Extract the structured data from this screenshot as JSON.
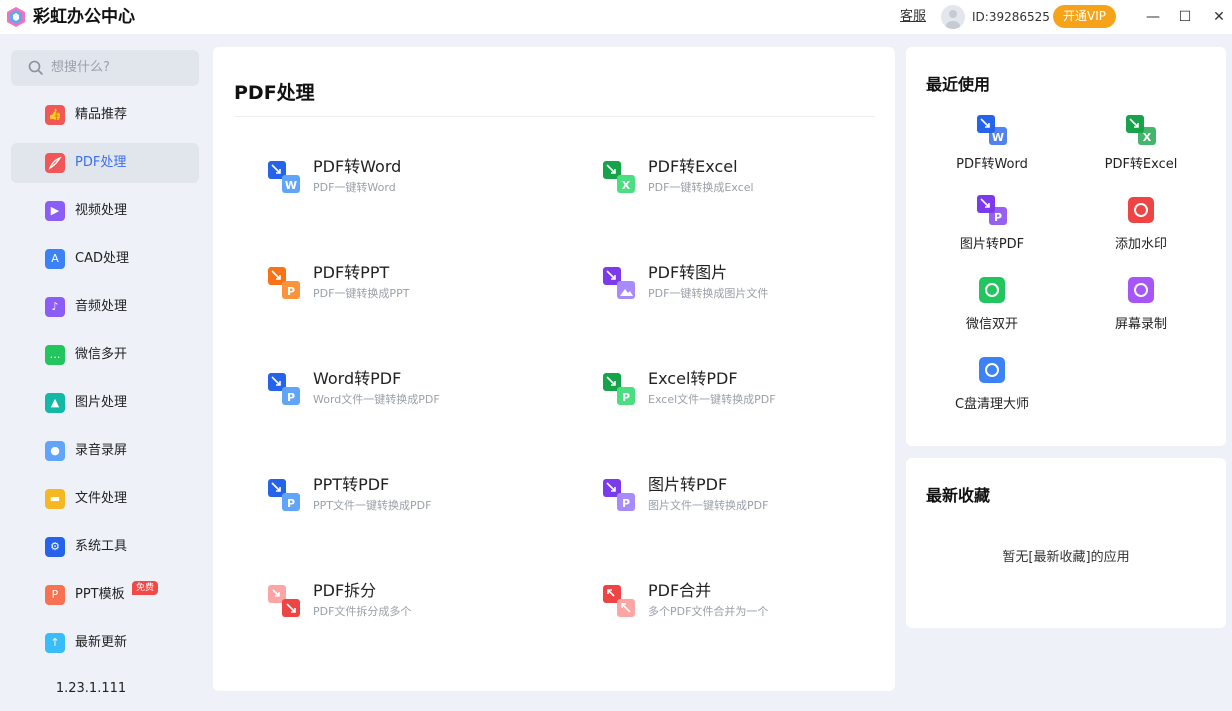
{
  "app": {
    "title": "彩虹办公中心"
  },
  "header": {
    "support": "客服",
    "user_id": "ID:39286525",
    "vip_button": "开通VIP",
    "minimize": "—",
    "maximize": "☐",
    "close": "✕"
  },
  "sidebar": {
    "search_placeholder": "想搜什么?",
    "items": [
      {
        "label": "精品推荐",
        "color": "#f25757"
      },
      {
        "label": "PDF处理",
        "color": "#f25757"
      },
      {
        "label": "视频处理",
        "color": "#8b5cf6"
      },
      {
        "label": "CAD处理",
        "color": "#3b82f6"
      },
      {
        "label": "音频处理",
        "color": "#8b5cf6"
      },
      {
        "label": "微信多开",
        "color": "#22c55e"
      },
      {
        "label": "图片处理",
        "color": "#14b8a6"
      },
      {
        "label": "录音录屏",
        "color": "#60a5fa"
      },
      {
        "label": "文件处理",
        "color": "#f5b823"
      },
      {
        "label": "系统工具",
        "color": "#2563eb"
      },
      {
        "label": "PPT模板",
        "color": "#f87150",
        "badge": "免费"
      },
      {
        "label": "最新更新",
        "color": "#38bdf8"
      }
    ],
    "version": "1.23.1.111"
  },
  "main": {
    "title": "PDF处理",
    "tools": [
      {
        "name": "PDF转Word",
        "desc": "PDF一键转Word",
        "letter": "W",
        "c1": "#2563eb",
        "c2": "#60a5fa"
      },
      {
        "name": "PDF转Excel",
        "desc": "PDF一键转换成Excel",
        "letter": "X",
        "c1": "#16a34a",
        "c2": "#4ade80"
      },
      {
        "name": "PDF转PPT",
        "desc": "PDF一键转换成PPT",
        "letter": "P",
        "c1": "#f97316",
        "c2": "#fb923c"
      },
      {
        "name": "PDF转图片",
        "desc": "PDF一键转换成图片文件",
        "letter": "img",
        "c1": "#7c3aed",
        "c2": "#a78bfa"
      },
      {
        "name": "Word转PDF",
        "desc": "Word文件一键转换成PDF",
        "letter": "P",
        "c1": "#2563eb",
        "c2": "#60a5fa"
      },
      {
        "name": "Excel转PDF",
        "desc": "Excel文件一键转换成PDF",
        "letter": "P",
        "c1": "#16a34a",
        "c2": "#4ade80"
      },
      {
        "name": "PPT转PDF",
        "desc": "PPT文件一键转换成PDF",
        "letter": "P",
        "c1": "#2563eb",
        "c2": "#60a5fa"
      },
      {
        "name": "图片转PDF",
        "desc": "图片文件一键转换成PDF",
        "letter": "P",
        "c1": "#7c3aed",
        "c2": "#a78bfa"
      },
      {
        "name": "PDF拆分",
        "desc": "PDF文件拆分成多个",
        "letter": "split",
        "c1": "#ef4444",
        "c2": "#fca5a5"
      },
      {
        "name": "PDF合并",
        "desc": "多个PDF文件合并为一个",
        "letter": "merge",
        "c1": "#ef4444",
        "c2": "#fca5a5"
      }
    ]
  },
  "recent": {
    "title": "最近使用",
    "items": [
      {
        "label": "PDF转Word",
        "color": "#2563eb"
      },
      {
        "label": "PDF转Excel",
        "color": "#16a34a"
      },
      {
        "label": "图片转PDF",
        "color": "#7c3aed"
      },
      {
        "label": "添加水印",
        "color": "#ef4444"
      },
      {
        "label": "微信双开",
        "color": "#22c55e"
      },
      {
        "label": "屏幕录制",
        "color": "#a855f7"
      },
      {
        "label": "C盘清理大师",
        "color": "#3b82f6"
      }
    ]
  },
  "favorites": {
    "title": "最新收藏",
    "empty": "暂无[最新收藏]的应用"
  }
}
